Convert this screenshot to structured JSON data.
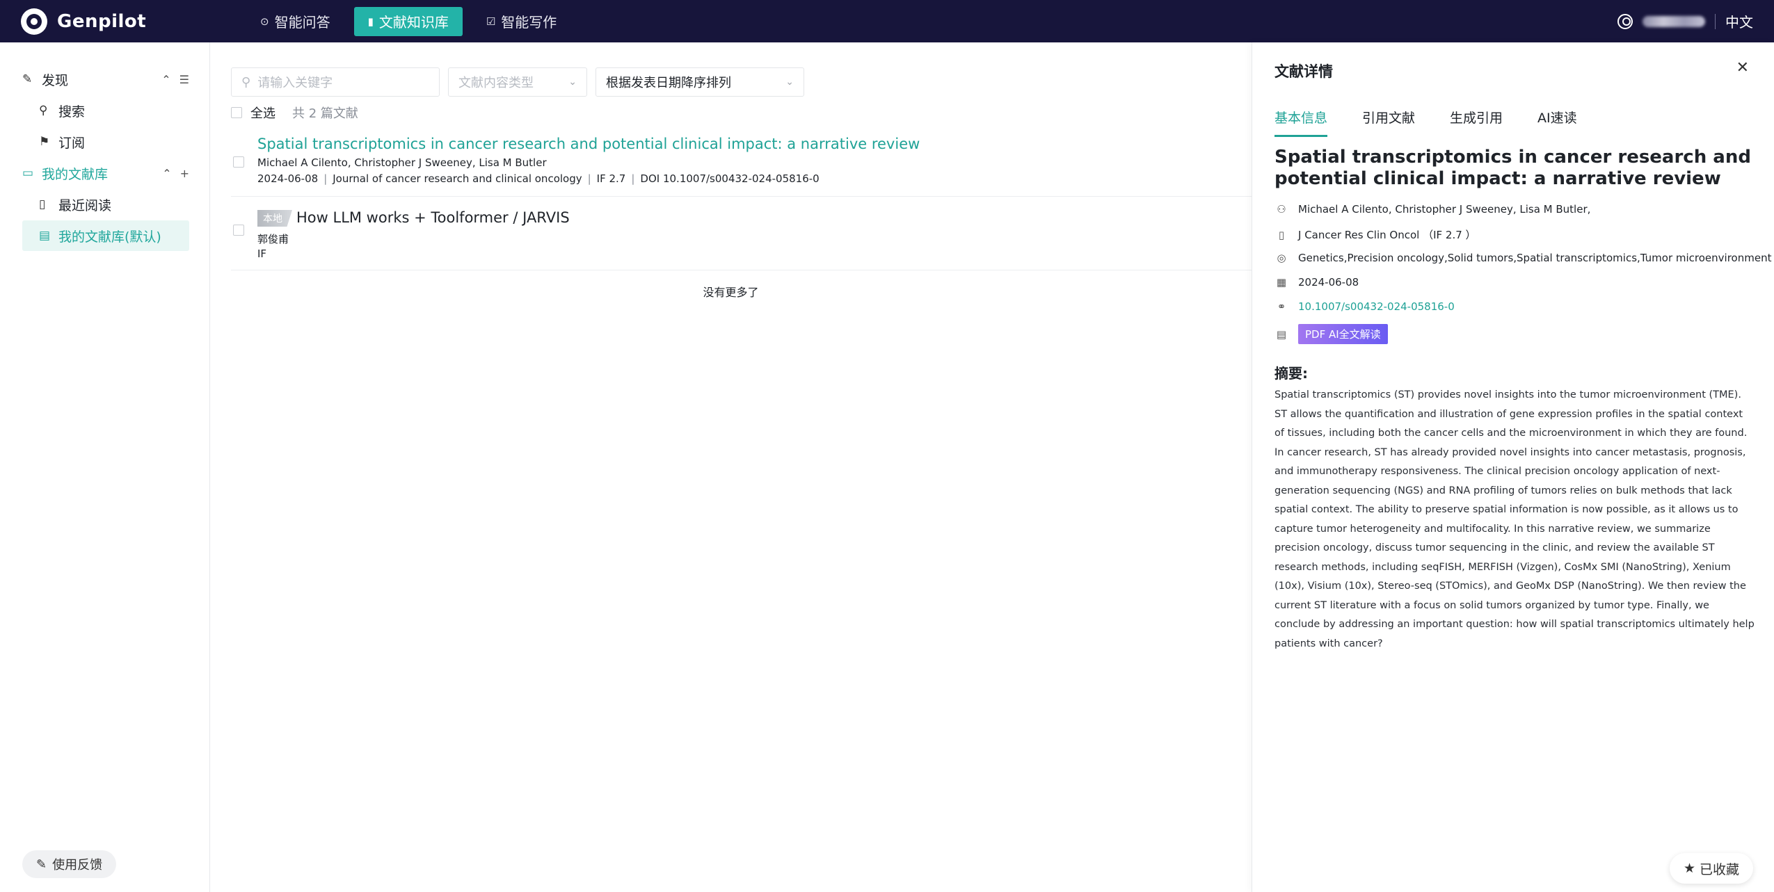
{
  "brand": {
    "name": "Genpilot"
  },
  "nav": {
    "tabs": [
      {
        "label": "智能问答",
        "icon": "chat-icon"
      },
      {
        "label": "文献知识库",
        "icon": "book-icon",
        "active": true
      },
      {
        "label": "智能写作",
        "icon": "edit-icon"
      }
    ],
    "language": "中文"
  },
  "sidebar": {
    "discover": {
      "label": "发现",
      "icon": "compass-icon"
    },
    "search": {
      "label": "搜索",
      "icon": "search-icon"
    },
    "subscribe": {
      "label": "订阅",
      "icon": "bookmark-icon"
    },
    "my_library": {
      "label": "我的文献库",
      "icon": "folder-icon"
    },
    "recent": {
      "label": "最近阅读",
      "icon": "open-book-icon"
    },
    "default_library": {
      "label": "我的文献库(默认)",
      "icon": "document-icon"
    },
    "feedback_label": "使用反馈"
  },
  "filters": {
    "search_placeholder": "请输入关键字",
    "type_placeholder": "文献内容类型",
    "sort_value": "根据发表日期降序排列",
    "select_all": "全选",
    "count_text": "共 2 篇文献"
  },
  "papers": [
    {
      "title": "Spatial transcriptomics in cancer research and potential clinical impact: a narrative review",
      "authors": "Michael A Cilento, Christopher J Sweeney, Lisa M Butler",
      "date": "2024-06-08",
      "journal": "Journal of cancer research and clinical oncology",
      "if": "IF 2.7",
      "doi": "DOI 10.1007/s00432-024-05816-0"
    },
    {
      "tag": "本地",
      "title": "How LLM works + Toolformer / JARVIS",
      "authors": "郭俊甫",
      "if": "IF"
    }
  ],
  "no_more": "没有更多了",
  "detail": {
    "header": "文献详情",
    "tabs": [
      "基本信息",
      "引用文献",
      "生成引用",
      "AI速读"
    ],
    "title": "Spatial transcriptomics in cancer research and potential clinical impact: a narrative review",
    "authors": "Michael A Cilento, Christopher J Sweeney, Lisa M Butler,",
    "journal": "J Cancer Res Clin Oncol （IF 2.7 ）",
    "keywords": "Genetics,Precision oncology,Solid tumors,Spatial transcriptomics,Tumor microenvironment",
    "date": "2024-06-08",
    "doi": "10.1007/s00432-024-05816-0",
    "pdf_button": "PDF AI全文解读",
    "abstract_label": "摘要:",
    "abstract": "Spatial transcriptomics (ST) provides novel insights into the tumor microenvironment (TME). ST allows the quantification and illustration of gene expression profiles in the spatial context of tissues, including both the cancer cells and the microenvironment in which they are found. In cancer research, ST has already provided novel insights into cancer metastasis, prognosis, and immunotherapy responsiveness. The clinical precision oncology application of next-generation sequencing (NGS) and RNA profiling of tumors relies on bulk methods that lack spatial context. The ability to preserve spatial information is now possible, as it allows us to capture tumor heterogeneity and multifocality. In this narrative review, we summarize precision oncology, discuss tumor sequencing in the clinic, and review the available ST research methods, including seqFISH, MERFISH (Vizgen), CosMx SMI (NanoString), Xenium (10x), Visium (10x), Stereo-seq (STOmics), and GeoMx DSP (NanoString). We then review the current ST literature with a focus on solid tumors organized by tumor type. Finally, we conclude by addressing an important question: how will spatial transcriptomics ultimately help patients with cancer?",
    "favorite_label": "已收藏"
  },
  "colors": {
    "accent": "#1fa296",
    "topbar": "#17153b"
  }
}
